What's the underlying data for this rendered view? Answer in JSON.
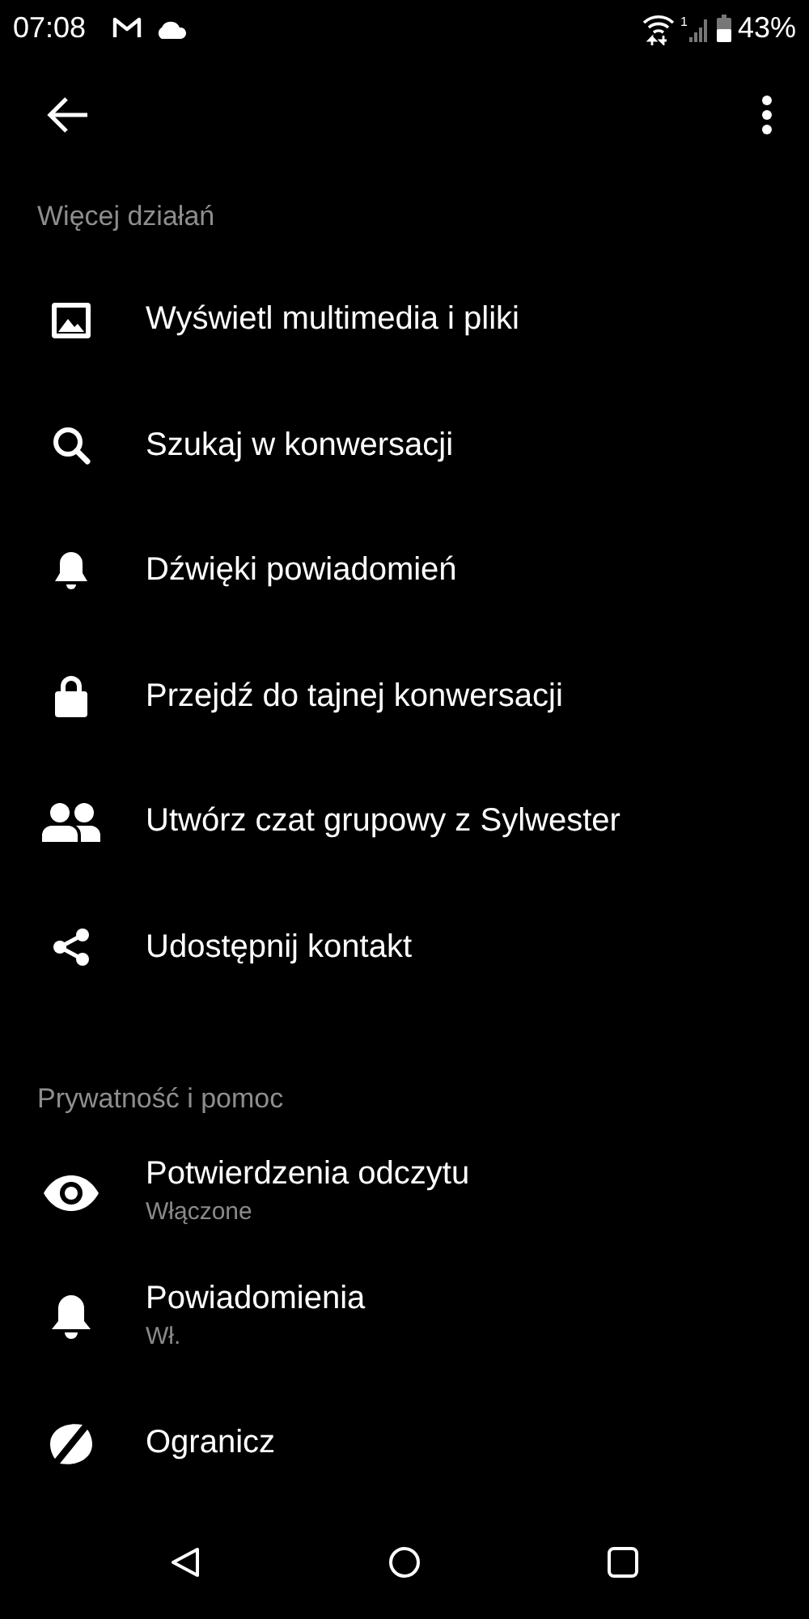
{
  "status_bar": {
    "time": "07:08",
    "battery": "43%",
    "signal_sim": "1"
  },
  "sections": [
    {
      "title": "Więcej działań",
      "items": [
        {
          "label": "Wyświetl multimedia i pliki"
        },
        {
          "label": "Szukaj w konwersacji"
        },
        {
          "label": "Dźwięki powiadomień"
        },
        {
          "label": "Przejdź do tajnej konwersacji"
        },
        {
          "label": "Utwórz czat grupowy z Sylwester"
        },
        {
          "label": "Udostępnij kontakt"
        }
      ]
    },
    {
      "title": "Prywatność i pomoc",
      "items": [
        {
          "label": "Potwierdzenia odczytu",
          "subtitle": "Włączone"
        },
        {
          "label": "Powiadomienia",
          "subtitle": "Wł."
        },
        {
          "label": "Ogranicz"
        }
      ]
    }
  ]
}
